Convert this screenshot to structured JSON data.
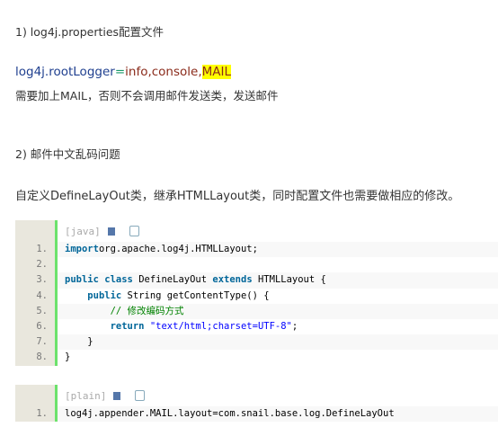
{
  "sections": {
    "s1": "1) log4j.properties配置文件",
    "s2": "2) 邮件中文乱码问题"
  },
  "config_line": {
    "key": "log4j.rootLogger",
    "eq": "=",
    "values": "info,console,",
    "highlight": "MAIL"
  },
  "note": "需要加上MAIL，否则不会调用邮件发送类，发送邮件",
  "desc": "自定义DefineLayOut类，继承HTMLLayout类，同时配置文件也需要做相应的修改。",
  "code_block_1": {
    "lang": "[java]",
    "lines": [
      {
        "n": "1.",
        "parts": [
          [
            "kw",
            "import"
          ],
          [
            "",
            "org.apache.log4j.HTMLLayout;"
          ]
        ]
      },
      {
        "n": "2.",
        "parts": []
      },
      {
        "n": "3.",
        "parts": [
          [
            "kw",
            "public"
          ],
          [
            "kw",
            " class"
          ],
          [
            "",
            " DefineLayOut "
          ],
          [
            "kw",
            "extends"
          ],
          [
            "",
            " HTMLLayout {"
          ]
        ]
      },
      {
        "n": "4.",
        "parts": [
          [
            "",
            "    "
          ],
          [
            "kw",
            "public"
          ],
          [
            "",
            " String getContentType() {"
          ]
        ]
      },
      {
        "n": "5.",
        "parts": [
          [
            "",
            "        "
          ],
          [
            "cm",
            "// 修改编码方式"
          ]
        ]
      },
      {
        "n": "6.",
        "parts": [
          [
            "",
            "        "
          ],
          [
            "kw",
            "return"
          ],
          [
            "",
            " "
          ],
          [
            "st",
            "\"text/html;charset=UTF-8\""
          ],
          [
            "",
            ";"
          ]
        ]
      },
      {
        "n": "7.",
        "parts": [
          [
            "",
            "    }"
          ]
        ]
      },
      {
        "n": "8.",
        "parts": [
          [
            "",
            "}"
          ]
        ]
      }
    ]
  },
  "code_block_2": {
    "lang": "[plain]",
    "lines": [
      {
        "n": "1.",
        "parts": [
          [
            "",
            "log4j.appender.MAIL.layout=com.snail.base.log.DefineLayOut"
          ]
        ]
      }
    ]
  },
  "colors": {
    "gutter": "#e9e7dd",
    "border": "#6ce26c",
    "keyword": "#006699",
    "comment": "#008200",
    "string": "#0000ff",
    "highlight": "#ffff00"
  }
}
